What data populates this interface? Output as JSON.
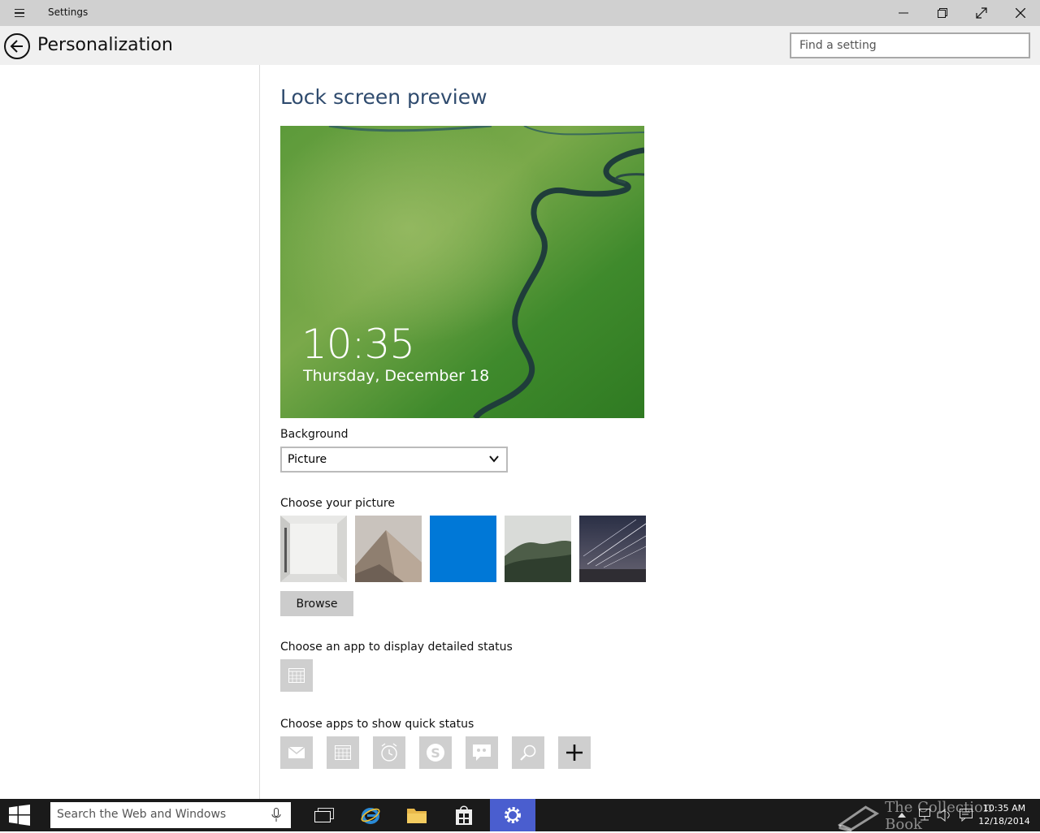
{
  "window": {
    "title": "Settings",
    "controls": [
      "minimize",
      "restore",
      "fullscreen",
      "close"
    ]
  },
  "header": {
    "page_title": "Personalization",
    "search_placeholder": "Find a setting"
  },
  "main": {
    "section_title": "Lock screen preview",
    "preview": {
      "time": "10:35",
      "date": "Thursday, December 18"
    },
    "background": {
      "label": "Background",
      "selected": "Picture"
    },
    "choose_picture": {
      "label": "Choose your picture",
      "thumbnails": [
        "white-room",
        "sand-dune",
        "blue-solid",
        "foggy-forest",
        "star-trails"
      ]
    },
    "browse_label": "Browse",
    "detailed_status": {
      "label": "Choose an app to display detailed status",
      "app_icon": "calendar-icon"
    },
    "quick_status": {
      "label": "Choose apps to show quick status",
      "apps": [
        "mail-icon",
        "calendar-icon",
        "alarm-icon",
        "skype-icon",
        "messaging-icon",
        "search-icon",
        "plus-icon"
      ]
    }
  },
  "taskbar": {
    "search_placeholder": "Search the Web and Windows",
    "clock_time": "10:35 AM",
    "clock_date": "12/18/2014",
    "active_color": "#4a5ecf"
  },
  "watermark": {
    "text": "The Collection Book"
  },
  "colors": {
    "titlebar": "#d0d0d0",
    "header": "#f0f0f0",
    "section_title": "#2f4b6e",
    "accent_blue": "#0078d7",
    "taskbar": "#1a1a1a"
  }
}
